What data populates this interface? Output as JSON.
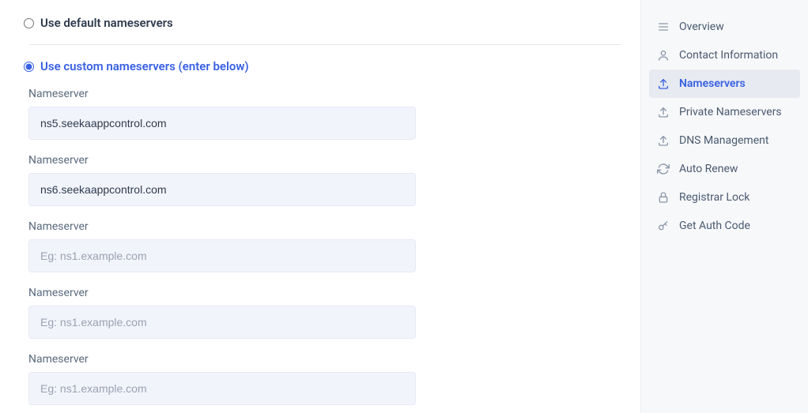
{
  "options": {
    "default_label": "Use default nameservers",
    "custom_label": "Use custom nameservers (enter below)"
  },
  "fields": [
    {
      "label": "Nameserver",
      "value": "ns5.seekaappcontrol.com",
      "placeholder": "Eg: ns1.example.com"
    },
    {
      "label": "Nameserver",
      "value": "ns6.seekaappcontrol.com",
      "placeholder": "Eg: ns1.example.com"
    },
    {
      "label": "Nameserver",
      "value": "",
      "placeholder": "Eg: ns1.example.com"
    },
    {
      "label": "Nameserver",
      "value": "",
      "placeholder": "Eg: ns1.example.com"
    },
    {
      "label": "Nameserver",
      "value": "",
      "placeholder": "Eg: ns1.example.com"
    }
  ],
  "sidebar": {
    "items": [
      {
        "icon": "list-icon",
        "label": "Overview"
      },
      {
        "icon": "user-icon",
        "label": "Contact Information"
      },
      {
        "icon": "upload-icon",
        "label": "Nameservers"
      },
      {
        "icon": "upload-icon",
        "label": "Private Nameservers"
      },
      {
        "icon": "upload-icon",
        "label": "DNS Management"
      },
      {
        "icon": "refresh-icon",
        "label": "Auto Renew"
      },
      {
        "icon": "lock-icon",
        "label": "Registrar Lock"
      },
      {
        "icon": "key-icon",
        "label": "Get Auth Code"
      }
    ],
    "active_index": 2
  }
}
